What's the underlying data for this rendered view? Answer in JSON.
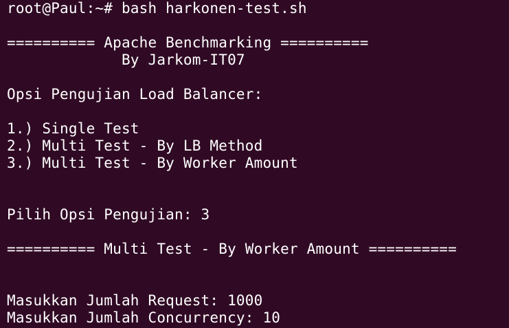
{
  "terminal": {
    "prompt": "root@Paul:~#",
    "command": "bash harkonen-test.sh",
    "banner_title": "========== Apache Benchmarking ==========",
    "banner_author": "             By Jarkom-IT07",
    "menu_heading": "Opsi Pengujian Load Balancer:",
    "options": [
      "1.) Single Test",
      "2.) Multi Test - By LB Method",
      "3.) Multi Test - By Worker Amount"
    ],
    "choice_prompt": "Pilih Opsi Pengujian: 3",
    "section_title": "========== Multi Test - By Worker Amount ==========",
    "request_prompt": "Masukkan Jumlah Request: 1000",
    "concurrency_prompt": "Masukkan Jumlah Concurrency: 10"
  },
  "colors": {
    "background": "#300a24",
    "foreground": "#ffffff"
  }
}
